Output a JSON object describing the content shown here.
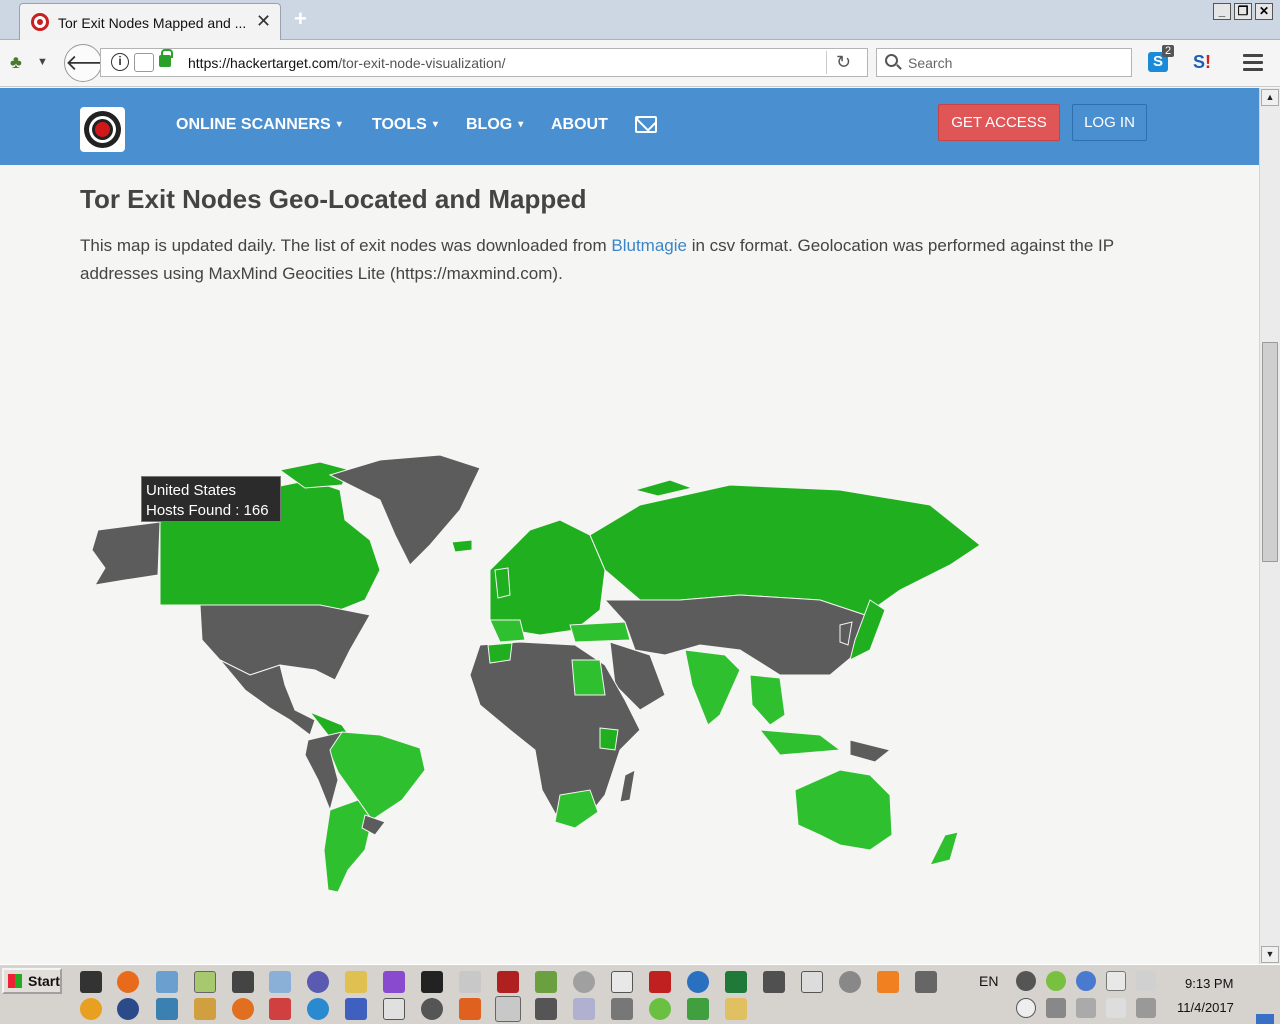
{
  "browser": {
    "tab_title": "Tor Exit Nodes Mapped and ...",
    "url_host": "https://hackertarget.com",
    "url_path": "/tor-exit-node-visualization/",
    "search_placeholder": "Search",
    "ext_badge": "2",
    "icons": [
      "tor-icon",
      "back-icon",
      "info-icon",
      "lock-icon",
      "reload-icon",
      "search-icon",
      "menu-icon"
    ]
  },
  "site": {
    "nav": [
      {
        "label": "ONLINE SCANNERS",
        "dropdown": true
      },
      {
        "label": "TOOLS",
        "dropdown": true
      },
      {
        "label": "BLOG",
        "dropdown": true
      },
      {
        "label": "ABOUT",
        "dropdown": false
      }
    ],
    "get_access": "GET ACCESS",
    "log_in": "LOG IN",
    "colors": {
      "nav_bg": "#4a8fd0",
      "accent_red": "#e05555",
      "map_active": "#22c022",
      "map_inactive": "#5c5c5c"
    }
  },
  "content": {
    "title": "Tor Exit Nodes Geo-Located and Mapped",
    "desc_1": "This map is updated daily. The list of exit nodes was downloaded from ",
    "desc_link": "Blutmagie",
    "desc_2": " in csv format. Geolocation was performed against the IP addresses using MaxMind Geocities Lite (https://maxmind.com)."
  },
  "map": {
    "tooltip_country": "United States",
    "tooltip_hosts": "Hosts Found : 166"
  },
  "taskbar": {
    "start": "Start",
    "lang": "EN",
    "time": "9:13 PM",
    "date": "11/4/2017"
  }
}
